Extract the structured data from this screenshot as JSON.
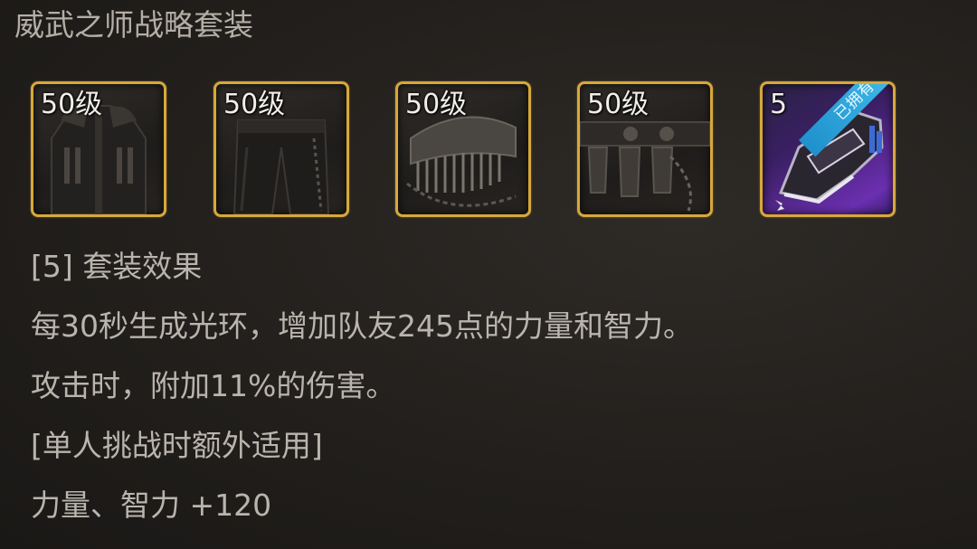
{
  "set": {
    "title": "威武之师战略套装"
  },
  "items": [
    {
      "level": "50级",
      "icon": "coat-icon",
      "owned": false
    },
    {
      "level": "50级",
      "icon": "pants-icon",
      "owned": false
    },
    {
      "level": "50级",
      "icon": "shoulder-icon",
      "owned": false
    },
    {
      "level": "50级",
      "icon": "belt-icon",
      "owned": false
    },
    {
      "level": "5",
      "icon": "shoes-icon",
      "owned": true,
      "owned_badge": "已拥有"
    }
  ],
  "effect": {
    "header": "[5] 套装效果",
    "line1": "每30秒生成光环，增加队友245点的力量和智力。",
    "line2": "攻击时，附加11%的伤害。",
    "solo_note": "[单人挑战时额外适用]",
    "solo_bonus": "力量、智力 +120"
  },
  "colors": {
    "frame_gold": "#d7a83a",
    "owned_purple": "#6b2fb0",
    "owned_ribbon": "#45c3ef"
  }
}
